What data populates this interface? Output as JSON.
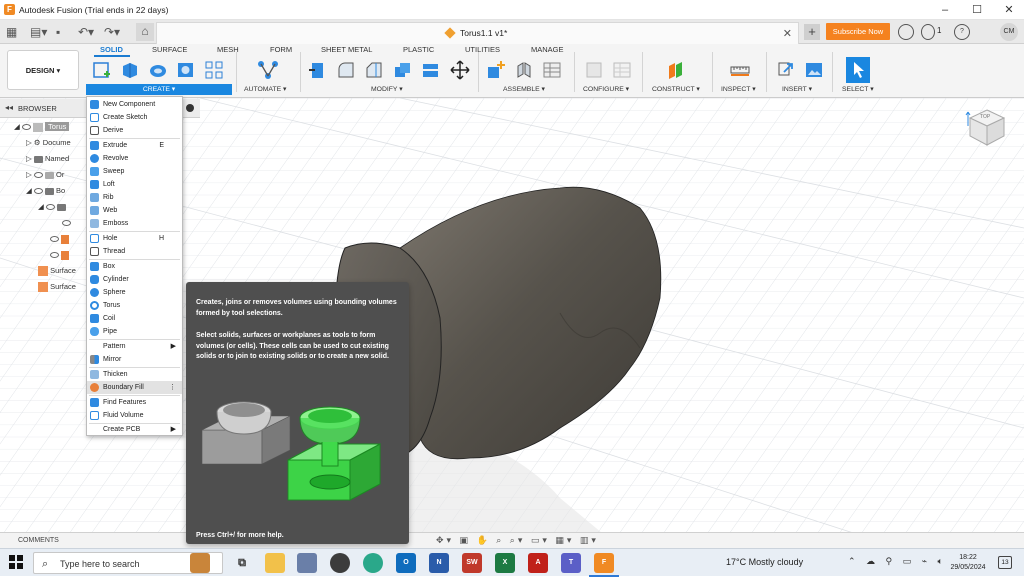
{
  "window": {
    "title": "Autodesk Fusion (Trial ends in 22 days)",
    "minimize": "–",
    "maximize": "☐",
    "close": "✕"
  },
  "tabstrip": {
    "doc_title": "Torus1.1 v1*",
    "doc_close": "✕",
    "plus": "+",
    "subscribe": "Subscribe Now",
    "notifications_count": "1",
    "user_initials": "CM"
  },
  "ribbon": {
    "design_button": "DESIGN ▾",
    "tabs": [
      "SOLID",
      "SURFACE",
      "MESH",
      "FORM",
      "SHEET METAL",
      "PLASTIC",
      "UTILITIES",
      "MANAGE"
    ],
    "groups": {
      "create": "CREATE ▾",
      "automate": "AUTOMATE ▾",
      "modify": "MODIFY ▾",
      "assemble": "ASSEMBLE ▾",
      "configure": "CONFIGURE ▾",
      "construct": "CONSTRUCT ▾",
      "inspect": "INSPECT ▾",
      "insert": "INSERT ▾",
      "select": "SELECT ▾"
    }
  },
  "browser": {
    "label": "BROWSER",
    "items": [
      "Torus",
      "Docume",
      "Named",
      "Or",
      "Bo",
      "Surface",
      "Surface"
    ]
  },
  "create_menu": {
    "items": [
      {
        "label": "New Component"
      },
      {
        "label": "Create Sketch"
      },
      {
        "label": "Derive"
      },
      {
        "label": "Extrude",
        "shortcut": "E"
      },
      {
        "label": "Revolve"
      },
      {
        "label": "Sweep"
      },
      {
        "label": "Loft"
      },
      {
        "label": "Rib"
      },
      {
        "label": "Web"
      },
      {
        "label": "Emboss"
      },
      {
        "label": "Hole",
        "shortcut": "H"
      },
      {
        "label": "Thread"
      },
      {
        "label": "Box"
      },
      {
        "label": "Cylinder"
      },
      {
        "label": "Sphere"
      },
      {
        "label": "Torus"
      },
      {
        "label": "Coil"
      },
      {
        "label": "Pipe"
      },
      {
        "label": "Pattern",
        "arrow": "▶"
      },
      {
        "label": "Mirror"
      },
      {
        "label": "Thicken"
      },
      {
        "label": "Boundary Fill",
        "more": "⋮"
      },
      {
        "label": "Find Features"
      },
      {
        "label": "Fluid Volume"
      },
      {
        "label": "Create PCB",
        "arrow": "▶"
      }
    ]
  },
  "tooltip": {
    "p1": "Creates, joins or removes volumes using bounding volumes formed by tool selections.",
    "p2": "Select solids, surfaces or workplanes as tools to form volumes (or cells). These cells can be used to cut existing solids or to join to existing solids or to create a new solid.",
    "help": "Press Ctrl+/ for more help."
  },
  "viewcube": {
    "face_label": "TOP"
  },
  "statusbar": {
    "comments": "COMMENTS"
  },
  "taskbar": {
    "search_placeholder": "Type here to search",
    "weather": "17°C  Mostly cloudy",
    "time": "18:22",
    "date": "29/05/2024",
    "notification_count": "13"
  },
  "colors": {
    "accent": "#1a87e0",
    "subscribe": "#f5821f",
    "tooltip_bg": "#4f4f4f",
    "model": "#5a564f",
    "boundary_fill_green": "#3fd94a"
  }
}
